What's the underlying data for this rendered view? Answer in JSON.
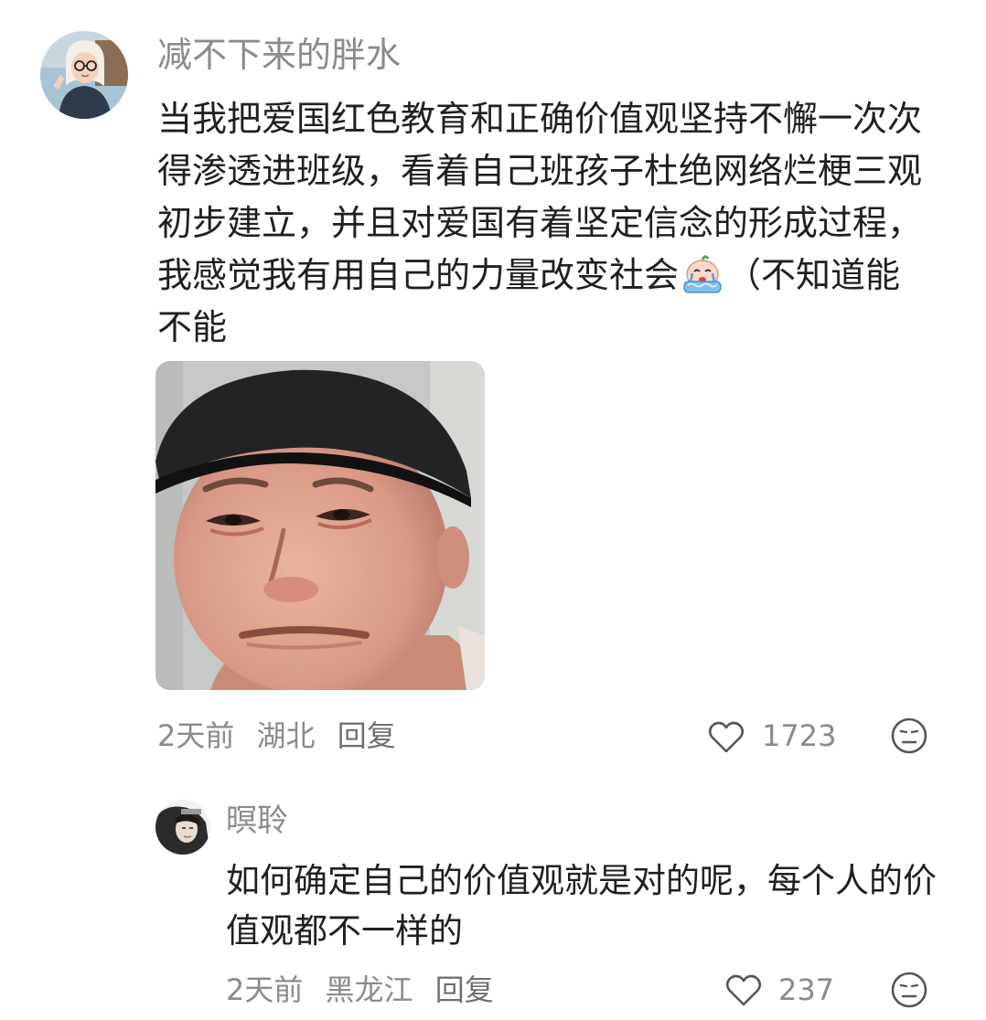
{
  "main_comment": {
    "username": "减不下来的胖水",
    "text_before_emoji": "当我把爱国红色教育和正确价值观坚持不懈一次次得渗透进班级，看着自己班孩子杜绝网络烂梗三观初步建立，并且对爱国有着坚定信念的形成过程，我感觉我有用自己的力量改变社会",
    "inline_emoji": "crying-emoji",
    "text_after_emoji": "（不知道能不能",
    "image": "crying-man-meme",
    "time": "2天前",
    "location": "湖北",
    "reply_label": "回复",
    "like_count": "1723",
    "icons": {
      "like": "heart-outline-icon",
      "dislike": "meh-face-icon"
    }
  },
  "reply_comment": {
    "username": "暝聆",
    "text": "如何确定自己的价值观就是对的呢，每个人的价值观都不一样的",
    "time": "2天前",
    "location": "黑龙江",
    "reply_label": "回复",
    "like_count": "237",
    "icons": {
      "like": "heart-outline-icon",
      "dislike": "meh-face-icon"
    }
  },
  "colors": {
    "text_primary": "#1f1f1f",
    "text_secondary": "#8a8a8a",
    "background": "#ffffff"
  }
}
